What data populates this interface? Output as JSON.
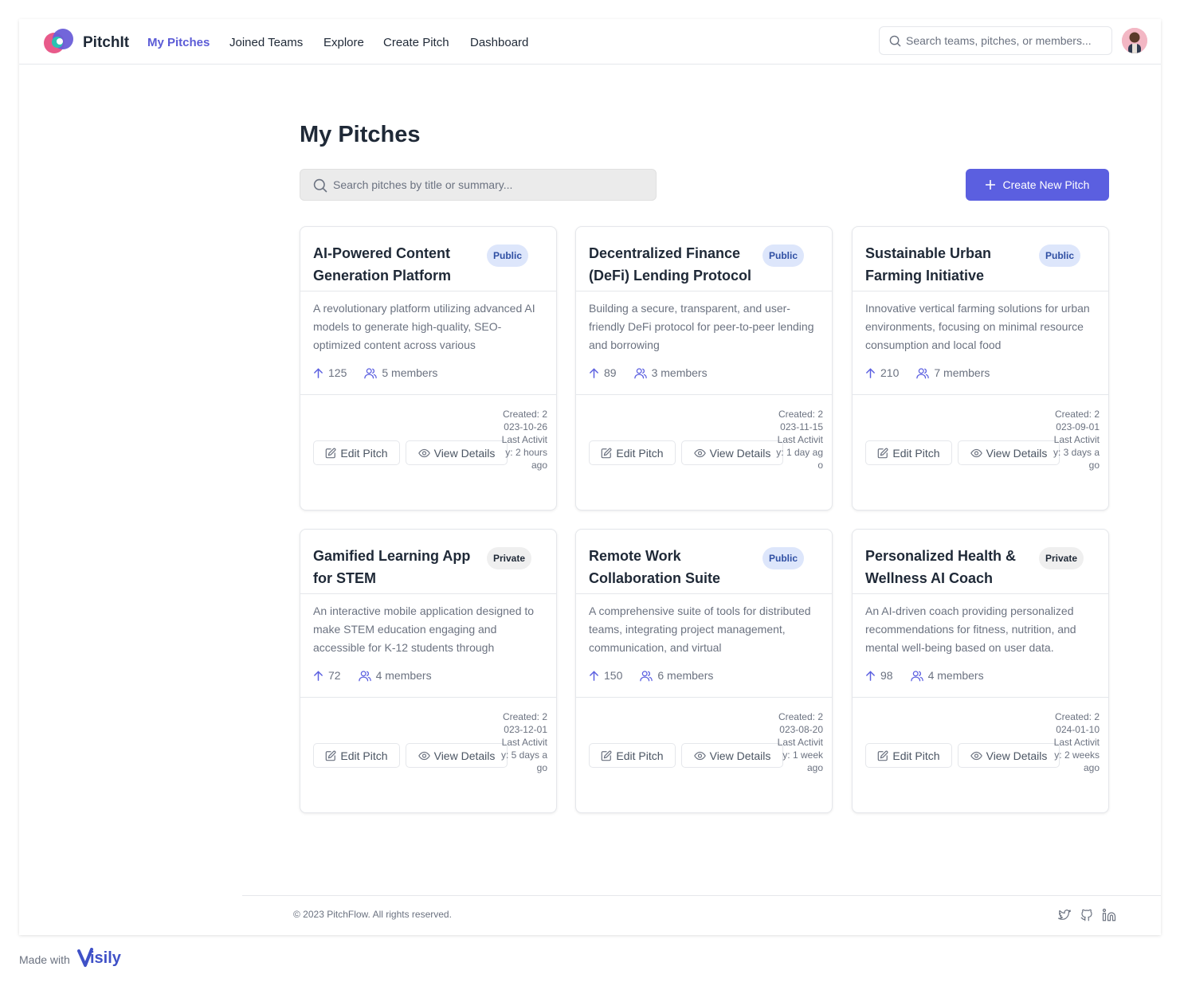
{
  "header": {
    "brand": "PitchIt",
    "nav": [
      "My Pitches",
      "Joined Teams",
      "Explore",
      "Create Pitch",
      "Dashboard"
    ],
    "search_placeholder": "Search teams, pitches, or members..."
  },
  "main": {
    "title": "My Pitches",
    "search_placeholder": "Search pitches by title or summary...",
    "create_label": "Create New Pitch"
  },
  "labels": {
    "edit": "Edit Pitch",
    "view": "View Details"
  },
  "cards": [
    {
      "title": "AI-Powered Content Generation Platform",
      "visibility": "Public",
      "summary": "A revolutionary platform utilizing advanced AI models to generate high-quality, SEO-optimized content across various",
      "votes": "125",
      "members": "5 members",
      "meta": "Created: 2023-10-26 Last Activity: 2 hours ago"
    },
    {
      "title": "Decentralized Finance (DeFi) Lending Protocol",
      "visibility": "Public",
      "summary": "Building a secure, transparent, and user-friendly DeFi protocol for peer-to-peer lending and borrowing",
      "votes": "89",
      "members": "3 members",
      "meta": "Created: 2023-11-15 Last Activity: 1 day ago"
    },
    {
      "title": "Sustainable Urban Farming Initiative",
      "visibility": "Public",
      "summary": "Innovative vertical farming solutions for urban environments, focusing on minimal resource consumption and local food",
      "votes": "210",
      "members": "7 members",
      "meta": "Created: 2023-09-01 Last Activity: 3 days ago"
    },
    {
      "title": "Gamified Learning App for STEM",
      "visibility": "Private",
      "summary": "An interactive mobile application designed to make STEM education engaging and accessible for K-12 students through",
      "votes": "72",
      "members": "4 members",
      "meta": "Created: 2023-12-01 Last Activity: 5 days ago"
    },
    {
      "title": "Remote Work Collaboration Suite",
      "visibility": "Public",
      "summary": "A comprehensive suite of tools for distributed teams, integrating project management, communication, and virtual",
      "votes": "150",
      "members": "6 members",
      "meta": "Created: 2023-08-20 Last Activity: 1 week ago"
    },
    {
      "title": "Personalized Health & Wellness AI Coach",
      "visibility": "Private",
      "summary": "An AI-driven coach providing personalized recommendations for fitness, nutrition, and mental well-being based on user data.",
      "votes": "98",
      "members": "4 members",
      "meta": "Created: 2024-01-10 Last Activity: 2 weeks ago"
    }
  ],
  "footer": {
    "copyright": "© 2023 PitchFlow. All rights reserved.",
    "social_icons": [
      "twitter-icon",
      "github-icon",
      "linkedin-icon"
    ]
  },
  "made_with": {
    "text": "Made with",
    "brand": "isily"
  },
  "colors": {
    "accent": "#5b5fe0",
    "nav_active": "#5b5bd6",
    "public_badge_bg": "#dde6fb",
    "public_badge_text": "#2f4fa3",
    "private_badge_bg": "#efefef"
  }
}
